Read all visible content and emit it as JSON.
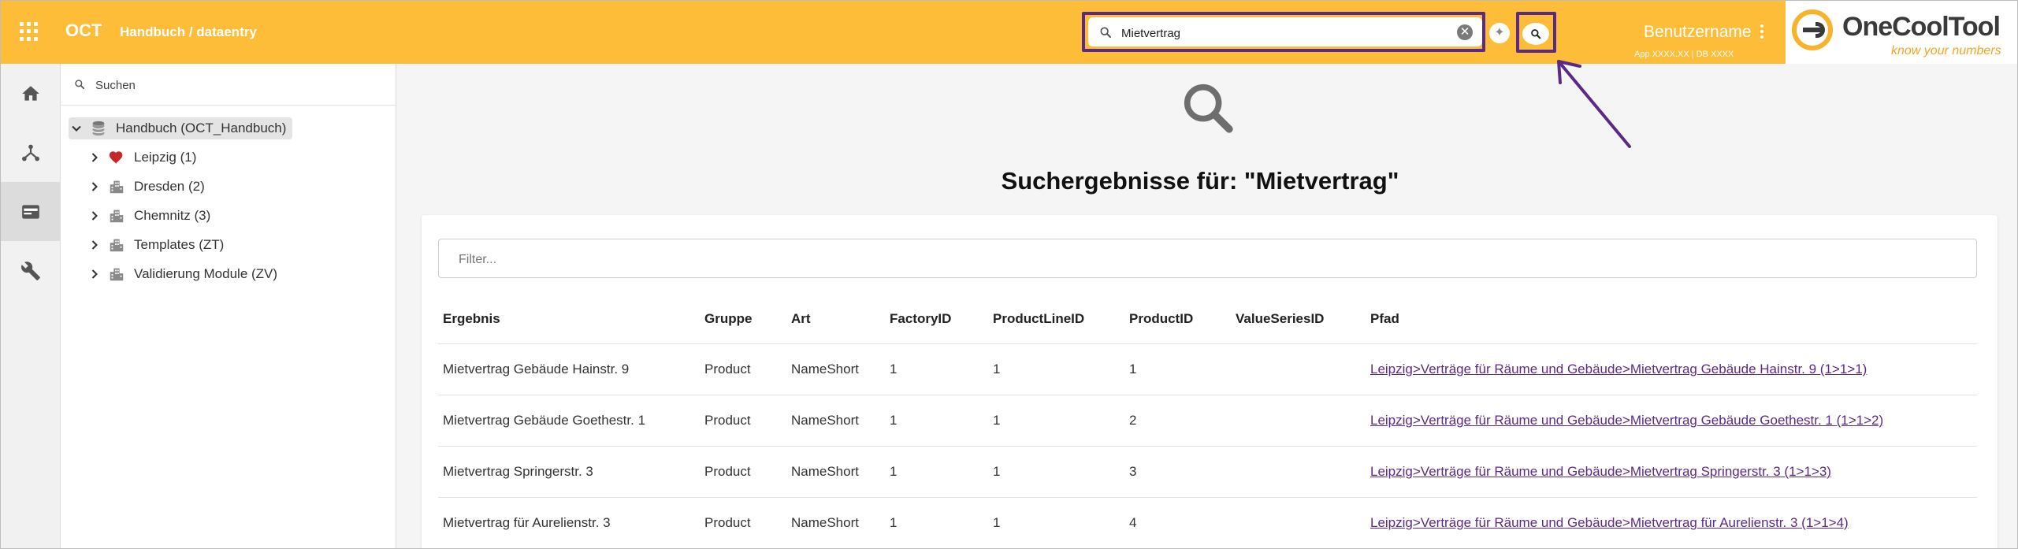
{
  "header": {
    "app_name": "OCT",
    "breadcrumb": "Handbuch / dataentry",
    "search_value": "Mietvertrag",
    "clear_symbol": "✕",
    "sparkle_symbol": "✦",
    "username": "Benutzername",
    "meta": "App  XXXX.XX  | DB  XXXX"
  },
  "logo": {
    "name": "OneCoolTool",
    "tagline": "know your numbers",
    "primary_color": "#f7b32b"
  },
  "nav_rail": [
    {
      "icon": "home-icon",
      "active": false
    },
    {
      "icon": "hierarchy-icon",
      "active": false
    },
    {
      "icon": "data-entry-icon",
      "active": true
    },
    {
      "icon": "wrench-icon",
      "active": false
    }
  ],
  "tree": {
    "search_placeholder": "Suchen",
    "root": {
      "label": "Handbuch (OCT_Handbuch)",
      "icon": "database-icon",
      "expanded": true
    },
    "items": [
      {
        "label": "Leipzig (1)",
        "icon": "heart-icon"
      },
      {
        "label": "Dresden (2)",
        "icon": "building-icon"
      },
      {
        "label": "Chemnitz (3)",
        "icon": "building-icon"
      },
      {
        "label": "Templates (ZT)",
        "icon": "building-icon"
      },
      {
        "label": "Validierung Module (ZV)",
        "icon": "building-icon"
      }
    ]
  },
  "results": {
    "title": "Suchergebnisse für: \"Mietvertrag\"",
    "filter_placeholder": "Filter...",
    "columns": [
      "Ergebnis",
      "Gruppe",
      "Art",
      "FactoryID",
      "ProductLineID",
      "ProductID",
      "ValueSeriesID",
      "Pfad"
    ],
    "rows": [
      {
        "ergebnis": "Mietvertrag Gebäude Hainstr. 9",
        "gruppe": "Product",
        "art": "NameShort",
        "factory": "1",
        "productline": "1",
        "product": "1",
        "valueseries": "",
        "pfad": "Leipzig>Verträge für Räume und Gebäude>Mietvertrag Gebäude Hainstr. 9 (1>1>1)"
      },
      {
        "ergebnis": "Mietvertrag Gebäude Goethestr. 1",
        "gruppe": "Product",
        "art": "NameShort",
        "factory": "1",
        "productline": "1",
        "product": "2",
        "valueseries": "",
        "pfad": "Leipzig>Verträge für Räume und Gebäude>Mietvertrag Gebäude Goethestr. 1 (1>1>2)"
      },
      {
        "ergebnis": "Mietvertrag Springerstr. 3",
        "gruppe": "Product",
        "art": "NameShort",
        "factory": "1",
        "productline": "1",
        "product": "3",
        "valueseries": "",
        "pfad": "Leipzig>Verträge für Räume und Gebäude>Mietvertrag Springerstr. 3 (1>1>3)"
      },
      {
        "ergebnis": "Mietvertrag für Aurelienstr. 3",
        "gruppe": "Product",
        "art": "NameShort",
        "factory": "1",
        "productline": "1",
        "product": "4",
        "valueseries": "",
        "pfad": "Leipzig>Verträge für Räume und Gebäude>Mietvertrag für Aurelienstr. 3 (1>1>4)"
      }
    ]
  },
  "colors": {
    "topbar": "#fdbd39",
    "highlight": "#5b2a86",
    "link": "#5b2a86",
    "heart": "#c62828"
  }
}
